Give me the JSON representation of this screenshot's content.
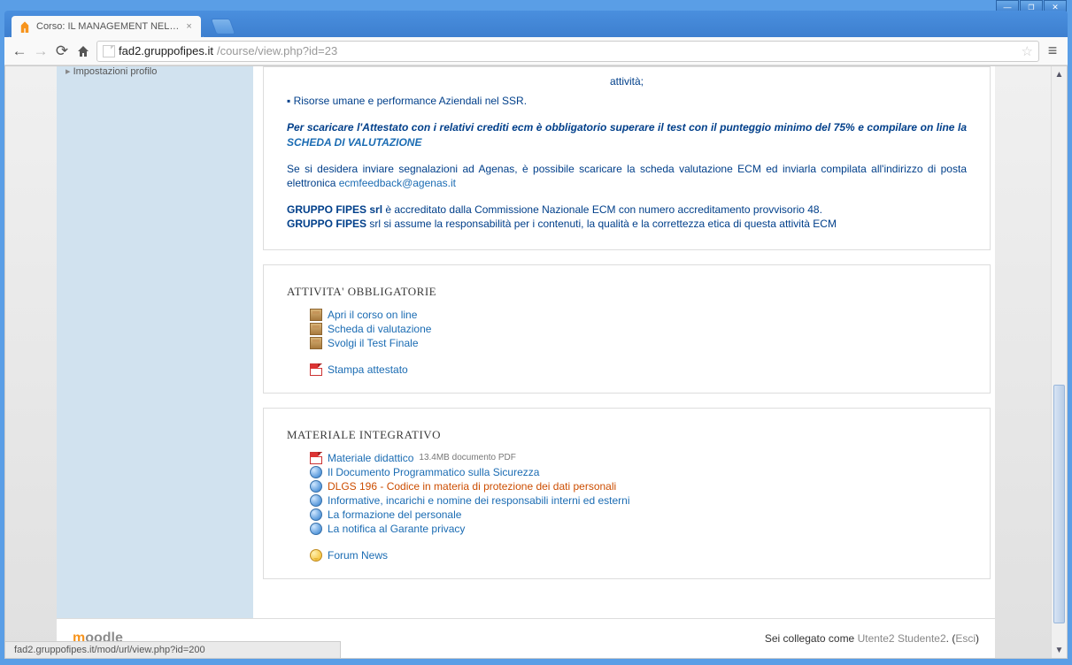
{
  "window": {
    "tab_title": "Corso: IL MANAGEMENT NEL…",
    "url_domain": "fad2.gruppofipes.it",
    "url_path": "/course/view.php?id=23"
  },
  "sidebar": {
    "profile": "Impostazioni profilo"
  },
  "intro": {
    "top_line": "attività;",
    "bullet": "Risorse umane e performance Aziendali nel SSR.",
    "attestato": "Per scaricare l'Attestato con i relativi crediti ecm è obbligatorio superare il test con il punteggio minimo del 75% e compilare on line la ",
    "scheda_link": "SCHEDA DI VALUTAZIONE",
    "agenas": "Se si desidera inviare segnalazioni ad Agenas, è possibile scaricare la scheda valutazione ECM ed inviarla compilata all'indirizzo di posta elettronica ",
    "email": "ecmfeedback@agenas.it",
    "gruppo1a": "GRUPPO FIPES srl",
    "gruppo1b": " è accreditato dalla Commissione Nazionale ECM con numero accreditamento provvisorio 48.",
    "gruppo2a": "GRUPPO FIPES",
    "gruppo2b": " srl si assume la responsabilità per i contenuti, la qualità e la correttezza etica di questa attività ECM"
  },
  "sec1": {
    "title": "ATTIVITA' OBBLIGATORIE",
    "items": [
      {
        "icon": "box",
        "label": "Apri il corso on line"
      },
      {
        "icon": "box",
        "label": "Scheda di valutazione"
      },
      {
        "icon": "box",
        "label": "Svolgi il Test Finale"
      }
    ],
    "extra": {
      "icon": "pdf",
      "label": "Stampa attestato"
    }
  },
  "sec2": {
    "title": "MATERIALE INTEGRATIVO",
    "items": [
      {
        "icon": "pdf",
        "label": "Materiale didattico",
        "meta": "13.4MB documento PDF"
      },
      {
        "icon": "web",
        "label": "Il Documento Programmatico sulla Sicurezza"
      },
      {
        "icon": "web",
        "label": "DLGS 196 - Codice in materia di protezione dei dati personali",
        "hover": true
      },
      {
        "icon": "web",
        "label": "Informative, incarichi e nomine dei responsabili interni ed esterni"
      },
      {
        "icon": "web",
        "label": "La formazione del personale"
      },
      {
        "icon": "web",
        "label": "La notifica al Garante privacy"
      }
    ],
    "forum": {
      "icon": "forum",
      "label": "Forum News"
    }
  },
  "footer": {
    "login_pre": "Sei collegato come ",
    "user": "Utente2 Studente2",
    "sep": ". (",
    "logout": "Esci",
    "close": ")"
  },
  "status": "fad2.gruppofipes.it/mod/url/view.php?id=200"
}
